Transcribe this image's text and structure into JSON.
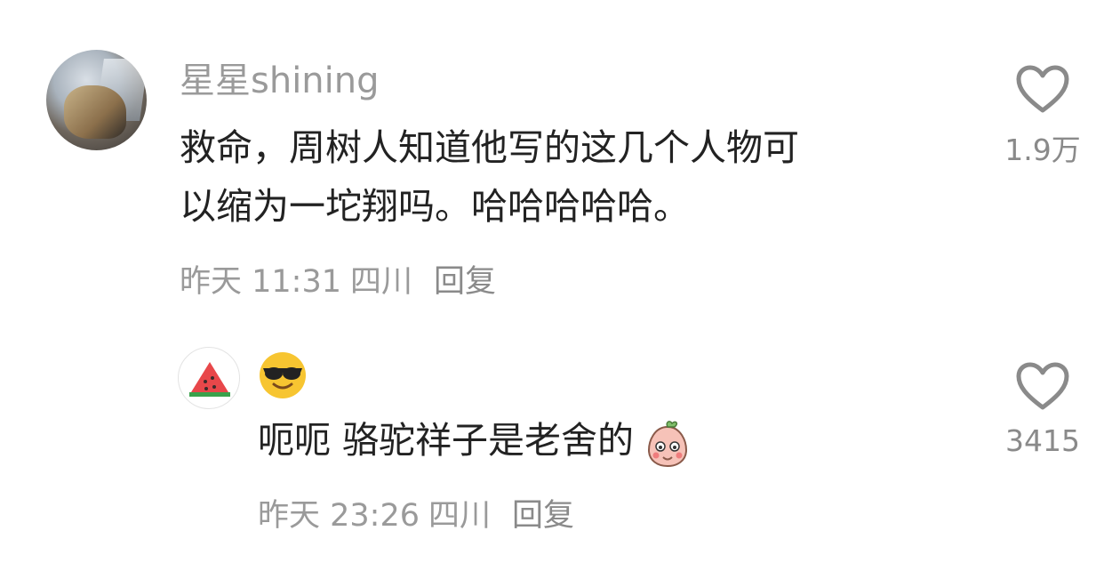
{
  "comments": [
    {
      "username": "星星shining",
      "text_line1": "救命，周树人知道他写的这几个人物可",
      "text_line2": "以缩为一坨翔吗。哈哈哈哈哈。",
      "time": "昨天 11:31",
      "location": "四川",
      "reply_label": "回复",
      "likes": "1.9万"
    },
    {
      "username_emoji": "sunglasses-emoji",
      "text": "呃呃 骆驼祥子是老舍的",
      "time": "昨天 23:26",
      "location": "四川",
      "reply_label": "回复",
      "likes": "3415"
    }
  ],
  "colors": {
    "username": "#9a9a9a",
    "text": "#222222",
    "meta": "#9a9a9a",
    "icon": "#8a8a8a"
  }
}
